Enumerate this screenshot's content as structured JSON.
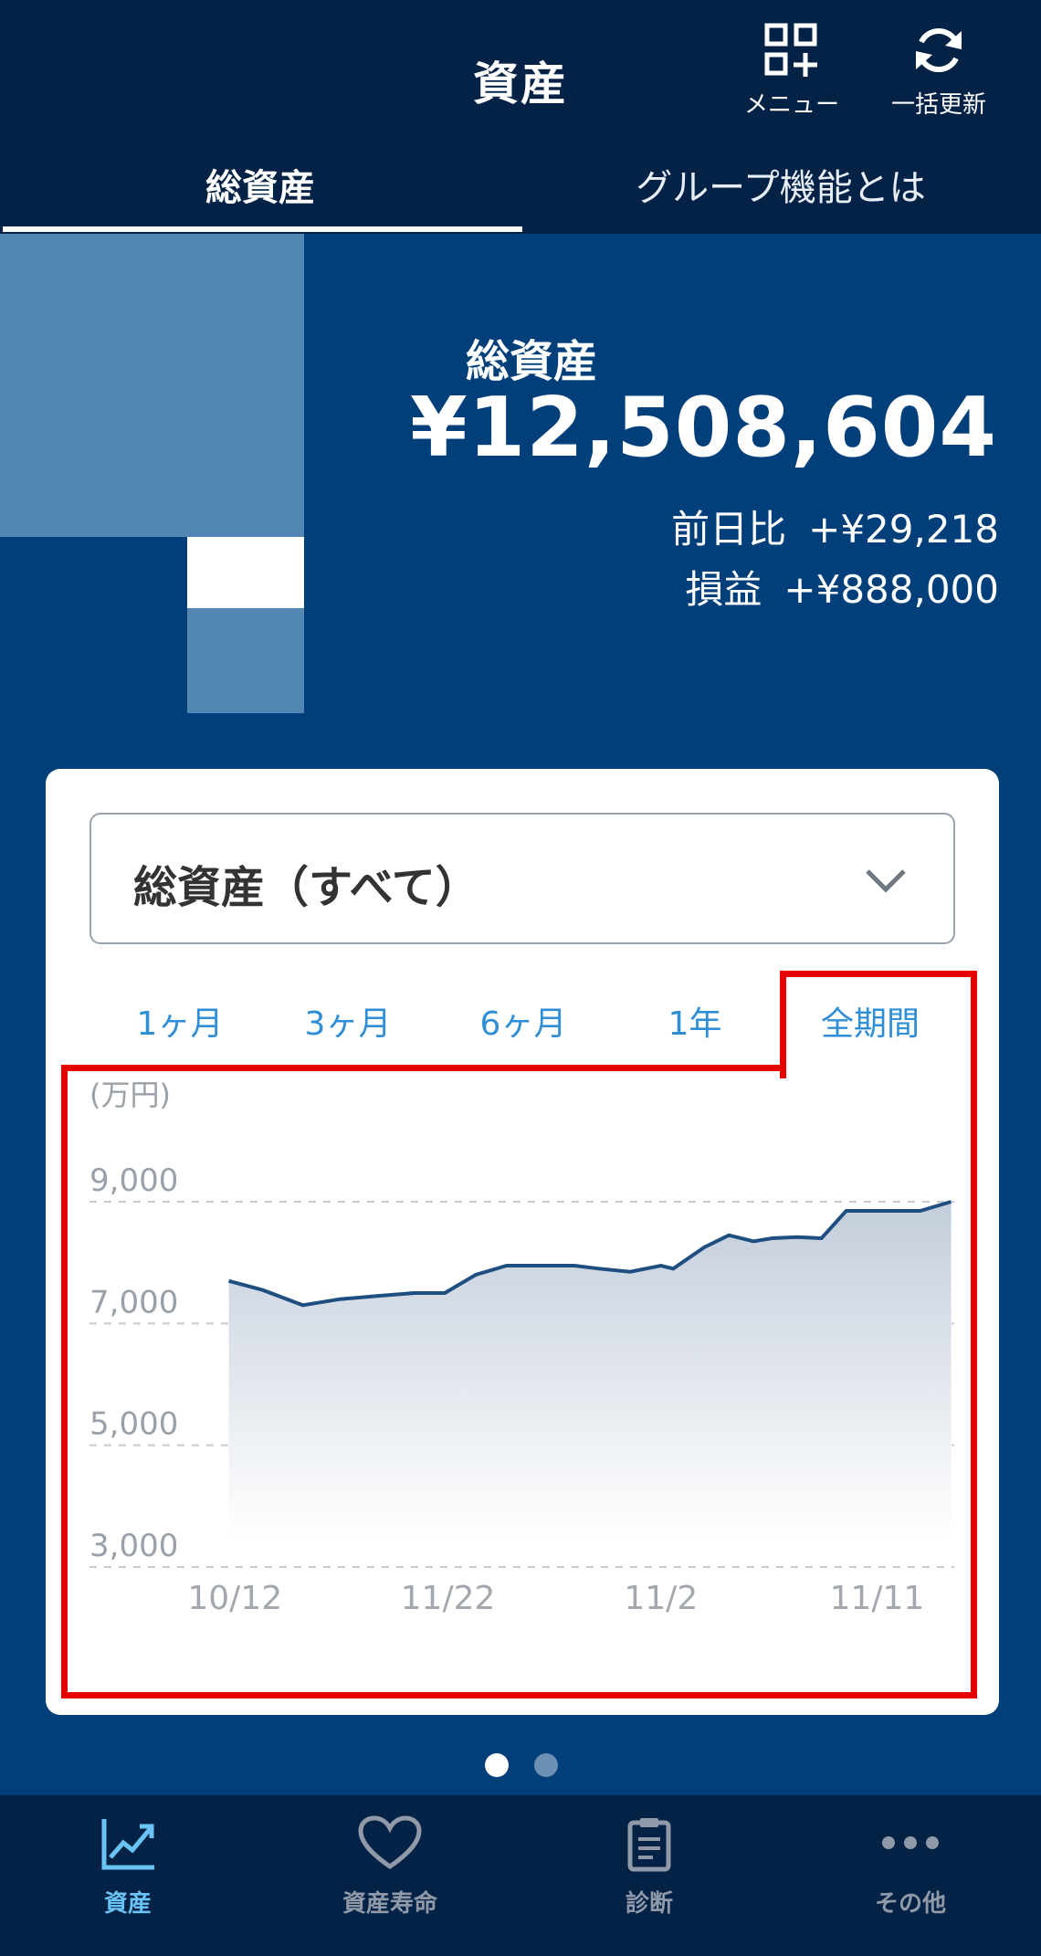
{
  "header": {
    "title": "資産",
    "menu_label": "メニュー",
    "refresh_label": "一括更新"
  },
  "tabs": [
    {
      "label": "総資産",
      "active": true
    },
    {
      "label": "グループ機能とは",
      "active": false
    }
  ],
  "summary": {
    "label": "総資産",
    "amount": "¥12,508,604",
    "day_change_label": "前日比",
    "day_change_value": "+¥29,218",
    "pl_label": "損益",
    "pl_value": "+¥888,000"
  },
  "filter": {
    "selected": "総資産（すべて）"
  },
  "periods": [
    {
      "label": "1ヶ月",
      "active": false
    },
    {
      "label": "3ヶ月",
      "active": false
    },
    {
      "label": "6ヶ月",
      "active": false
    },
    {
      "label": "1年",
      "active": false
    },
    {
      "label": "全期間",
      "active": true
    }
  ],
  "chart_data": {
    "type": "area",
    "ylabel": "(万円)",
    "ylim": [
      3000,
      9000
    ],
    "yticks": [
      3000,
      5000,
      7000,
      9000
    ],
    "ytick_labels": [
      "3,000",
      "5,000",
      "7,000",
      "9,000"
    ],
    "xtick_labels": [
      "10/12",
      "11/22",
      "11/2",
      "11/11"
    ],
    "xtick_positions": [
      0.1,
      3.55,
      7.0,
      10.5
    ],
    "grid": "dashed-horizontal",
    "colors": {
      "line": "#1f4f80",
      "fill_top": "#c3cddb",
      "fill_bottom": "#ffffff"
    },
    "series": [
      {
        "x": [
          0,
          0.55,
          1.2,
          1.8,
          2.4,
          3.0,
          3.5,
          4.0,
          4.5,
          5.0,
          5.6,
          6.0,
          6.5,
          7.0,
          7.2,
          7.7,
          8.1,
          8.5,
          8.8,
          9.2,
          9.6,
          10.0,
          10.5,
          11.2,
          11.7
        ],
        "y": [
          7700,
          7550,
          7300,
          7400,
          7450,
          7500,
          7500,
          7800,
          7950,
          7950,
          7950,
          7900,
          7850,
          7950,
          7900,
          8250,
          8450,
          8350,
          8400,
          8420,
          8400,
          8850,
          8850,
          8850,
          9000
        ]
      }
    ]
  },
  "pager": {
    "count": 2,
    "active_index": 0
  },
  "bottom_nav": [
    {
      "label": "資産",
      "icon": "chart-line-icon",
      "active": true
    },
    {
      "label": "資産寿命",
      "icon": "heart-icon",
      "active": false
    },
    {
      "label": "診断",
      "icon": "clipboard-icon",
      "active": false
    },
    {
      "label": "その他",
      "icon": "more-dots-icon",
      "active": false
    }
  ]
}
